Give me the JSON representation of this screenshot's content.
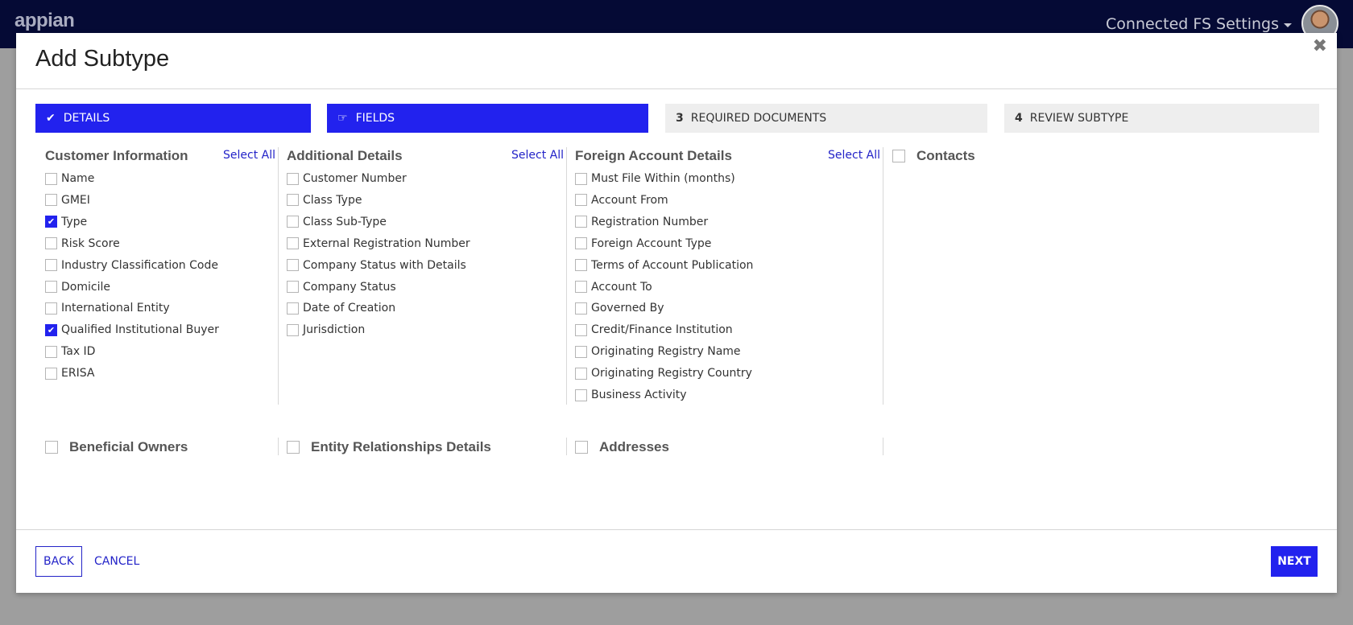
{
  "app": {
    "logo": "appian",
    "site_menu": "Connected FS Settings"
  },
  "modal": {
    "title": "Add Subtype",
    "close": "✖"
  },
  "steps": [
    {
      "num": "",
      "label": "DETAILS",
      "icon": "check-icon",
      "state": "complete"
    },
    {
      "num": "",
      "label": "FIELDS",
      "icon": "hand-pointer-icon",
      "state": "current"
    },
    {
      "num": "3",
      "label": "REQUIRED DOCUMENTS",
      "state": "upcoming"
    },
    {
      "num": "4",
      "label": "REVIEW SUBTYPE",
      "state": "upcoming"
    }
  ],
  "columns": [
    {
      "title": "Customer Information",
      "select_all": "Select All",
      "items": [
        {
          "label": "Name",
          "checked": false
        },
        {
          "label": "GMEI",
          "checked": false
        },
        {
          "label": "Type",
          "checked": true
        },
        {
          "label": "Risk Score",
          "checked": false
        },
        {
          "label": "Industry Classification Code",
          "checked": false
        },
        {
          "label": "Domicile",
          "checked": false
        },
        {
          "label": "International Entity",
          "checked": false
        },
        {
          "label": "Qualified Institutional Buyer",
          "checked": true
        },
        {
          "label": "Tax ID",
          "checked": false
        },
        {
          "label": "ERISA",
          "checked": false
        }
      ]
    },
    {
      "title": "Additional Details",
      "select_all": "Select All",
      "items": [
        {
          "label": "Customer Number",
          "checked": false
        },
        {
          "label": "Class Type",
          "checked": false
        },
        {
          "label": "Class Sub-Type",
          "checked": false
        },
        {
          "label": "External Registration Number",
          "checked": false
        },
        {
          "label": "Company Status with Details",
          "checked": false
        },
        {
          "label": "Company Status",
          "checked": false
        },
        {
          "label": "Date of Creation",
          "checked": false
        },
        {
          "label": "Jurisdiction",
          "checked": false
        }
      ]
    },
    {
      "title": "Foreign Account Details",
      "select_all": "Select All",
      "items": [
        {
          "label": "Must File Within (months)",
          "checked": false
        },
        {
          "label": "Account From",
          "checked": false
        },
        {
          "label": "Registration Number",
          "checked": false
        },
        {
          "label": "Foreign Account Type",
          "checked": false
        },
        {
          "label": "Terms of Account Publication",
          "checked": false
        },
        {
          "label": "Account To",
          "checked": false
        },
        {
          "label": "Governed By",
          "checked": false
        },
        {
          "label": "Credit/Finance Institution",
          "checked": false
        },
        {
          "label": "Originating Registry Name",
          "checked": false
        },
        {
          "label": "Originating Registry Country",
          "checked": false
        },
        {
          "label": "Business Activity",
          "checked": false
        }
      ]
    }
  ],
  "contacts": {
    "label": "Contacts",
    "checked": false
  },
  "bottom_sections": [
    {
      "label": "Beneficial Owners",
      "checked": false
    },
    {
      "label": "Entity Relationships Details",
      "checked": false
    },
    {
      "label": "Addresses",
      "checked": false
    }
  ],
  "footer": {
    "back": "BACK",
    "cancel": "CANCEL",
    "next": "NEXT"
  },
  "colors": {
    "accent": "#2222ee",
    "appbar": "#050a35",
    "link": "#2323c8"
  }
}
